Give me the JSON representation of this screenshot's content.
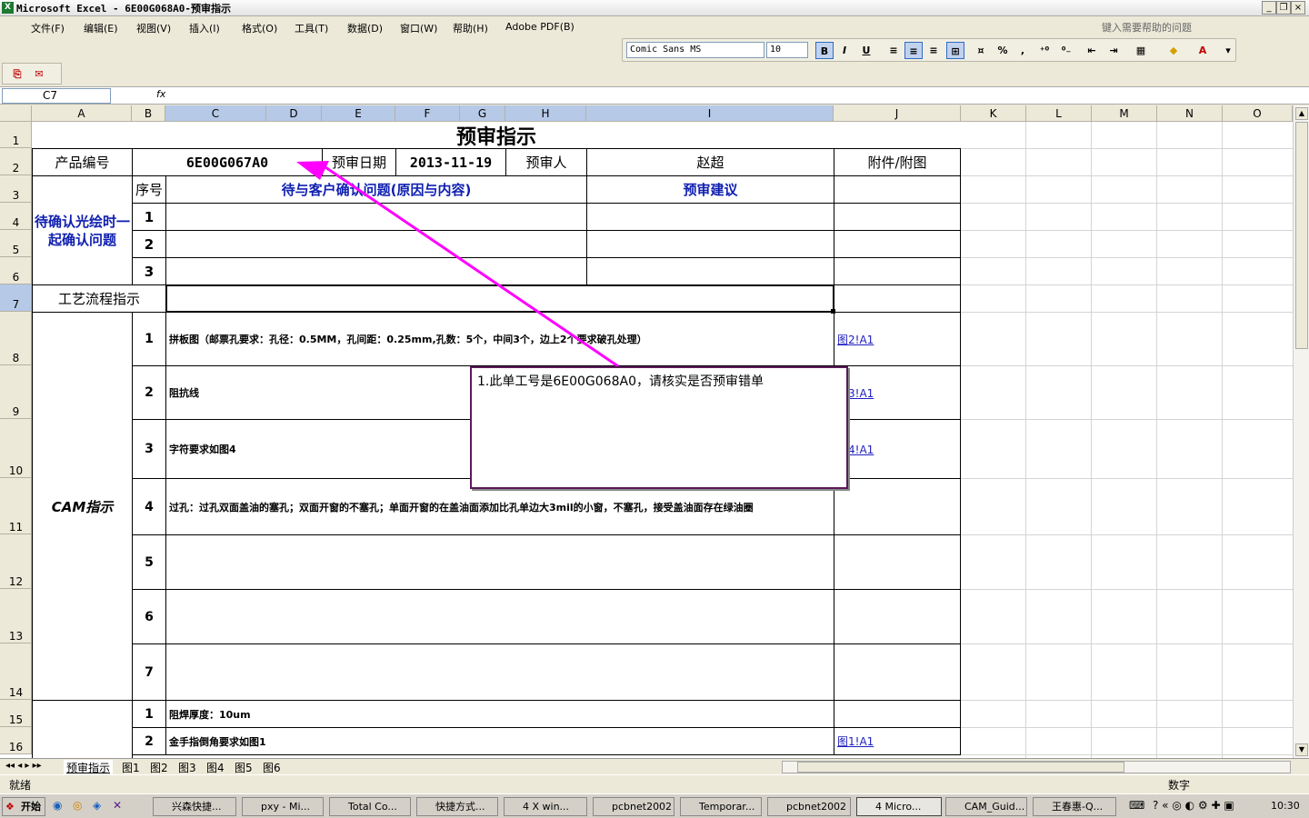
{
  "window": {
    "title": "Microsoft Excel - 6E00G068A0-预审指示",
    "minimize": "_",
    "restore": "❐",
    "close": "×"
  },
  "menu": {
    "items": [
      "文件(F)",
      "编辑(E)",
      "视图(V)",
      "插入(I)",
      "格式(O)",
      "工具(T)",
      "数据(D)",
      "窗口(W)",
      "帮助(H)",
      "Adobe PDF(B)"
    ],
    "help_placeholder": "键入需要帮助的问题"
  },
  "format_toolbar": {
    "font": "Comic Sans MS",
    "size": "10",
    "bold": "B",
    "italic": "I",
    "underline": "U",
    "percent": "%",
    "comma": ","
  },
  "formula_bar": {
    "name_box": "C7",
    "fx": "fx",
    "content": ""
  },
  "columns": [
    "A",
    "B",
    "C",
    "D",
    "E",
    "F",
    "G",
    "H",
    "I",
    "J",
    "K",
    "L",
    "M",
    "N",
    "O"
  ],
  "rows": [
    "1",
    "2",
    "3",
    "4",
    "5",
    "6",
    "7",
    "8",
    "9",
    "10",
    "11",
    "12",
    "13",
    "14",
    "15",
    "16"
  ],
  "sheet": {
    "title": "预审指示",
    "product_label": "产品编号",
    "product_no": "6E00G067A0",
    "date_label": "预审日期",
    "date": "2013-11-19",
    "reviewer_label": "预审人",
    "reviewer": "赵超",
    "attach_label": "附件/附图",
    "seq_label": "序号",
    "issue_header": "待与客户确认问题(原因与内容)",
    "suggest_header": "预审建议",
    "confirm_group": "待确认光绘时一起确认问题",
    "confirm_rows": [
      "1",
      "2",
      "3"
    ],
    "process_label": "工艺流程指示",
    "cam_label": "CAM指示",
    "cam_rows": [
      {
        "n": "1",
        "text": "拼板图（邮票孔要求：孔径：0.5MM，孔间距：0.25mm,孔数：5个，中间3个，边上2个要求破孔处理）",
        "link": "图2!A1"
      },
      {
        "n": "2",
        "text": "阻抗线",
        "link": "图3!A1"
      },
      {
        "n": "3",
        "text": "字符要求如图4",
        "link": "图4!A1"
      },
      {
        "n": "4",
        "text": "过孔：过孔双面盖油的塞孔；双面开窗的不塞孔；单面开窗的在盖油面添加比孔单边大3mil的小窗，不塞孔，接受盖油面存在绿油圈",
        "link": ""
      },
      {
        "n": "5",
        "text": "",
        "link": ""
      },
      {
        "n": "6",
        "text": "",
        "link": ""
      },
      {
        "n": "7",
        "text": "",
        "link": ""
      }
    ],
    "other_rows": [
      {
        "n": "1",
        "text": "阻焊厚度：10um",
        "link": ""
      },
      {
        "n": "2",
        "text": "金手指倒角要求如图1",
        "link": "图1!A1"
      }
    ],
    "comment": "1.此单工号是6E00G068A0，请核实是否预审错单"
  },
  "sheet_tabs": [
    "预审指示",
    "图1",
    "图2",
    "图3",
    "图4",
    "图5",
    "图6"
  ],
  "status": {
    "left": "就绪",
    "mode": "数字"
  },
  "taskbar": {
    "start": "开始",
    "tasks": [
      "兴森快捷...",
      "pxy - Mi...",
      "Total Co...",
      "快捷方式...",
      "4 X win...",
      "pcbnet2002",
      "Temporar...",
      "pcbnet2002",
      "4 Micro...",
      "CAM_Guid...",
      "王春惠-Q..."
    ],
    "clock": "10:30"
  },
  "colors": {
    "accent": "#1020b0",
    "arrow": "#ff00ff",
    "link": "#2020c0"
  }
}
